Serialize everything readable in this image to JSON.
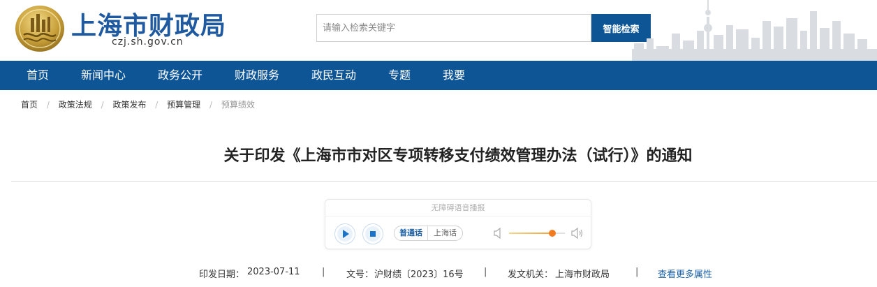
{
  "header": {
    "site_name": "上海市财政局",
    "site_domain": "czj.sh.gov.cn",
    "search_placeholder": "请输入检索关键字",
    "search_button": "智能检索",
    "brand_color": "#0e5596"
  },
  "nav": {
    "items": [
      "首页",
      "新闻中心",
      "政务公开",
      "财政服务",
      "政民互动",
      "专题",
      "我要"
    ]
  },
  "breadcrumb": {
    "items": [
      "首页",
      "政策法规",
      "政策发布",
      "预算管理"
    ],
    "current": "预算绩效"
  },
  "article": {
    "title": "关于印发《上海市市对区专项转移支付绩效管理办法（试行）》的通知"
  },
  "player": {
    "title": "无障碍语音播报",
    "lang_mandarin": "普通话",
    "lang_shanghai": "上海话",
    "volume_percent": 78,
    "play_icon": "play-icon",
    "stop_icon": "stop-icon"
  },
  "meta": {
    "date_label": "印发日期：",
    "date_value": "2023-07-11",
    "doc_no_label": "文号：",
    "doc_no_value": "沪财绩〔2023〕16号",
    "issuer_label": "发文机关：",
    "issuer_value": "上海市财政局",
    "more_link": "查看更多属性",
    "separator": "|"
  }
}
